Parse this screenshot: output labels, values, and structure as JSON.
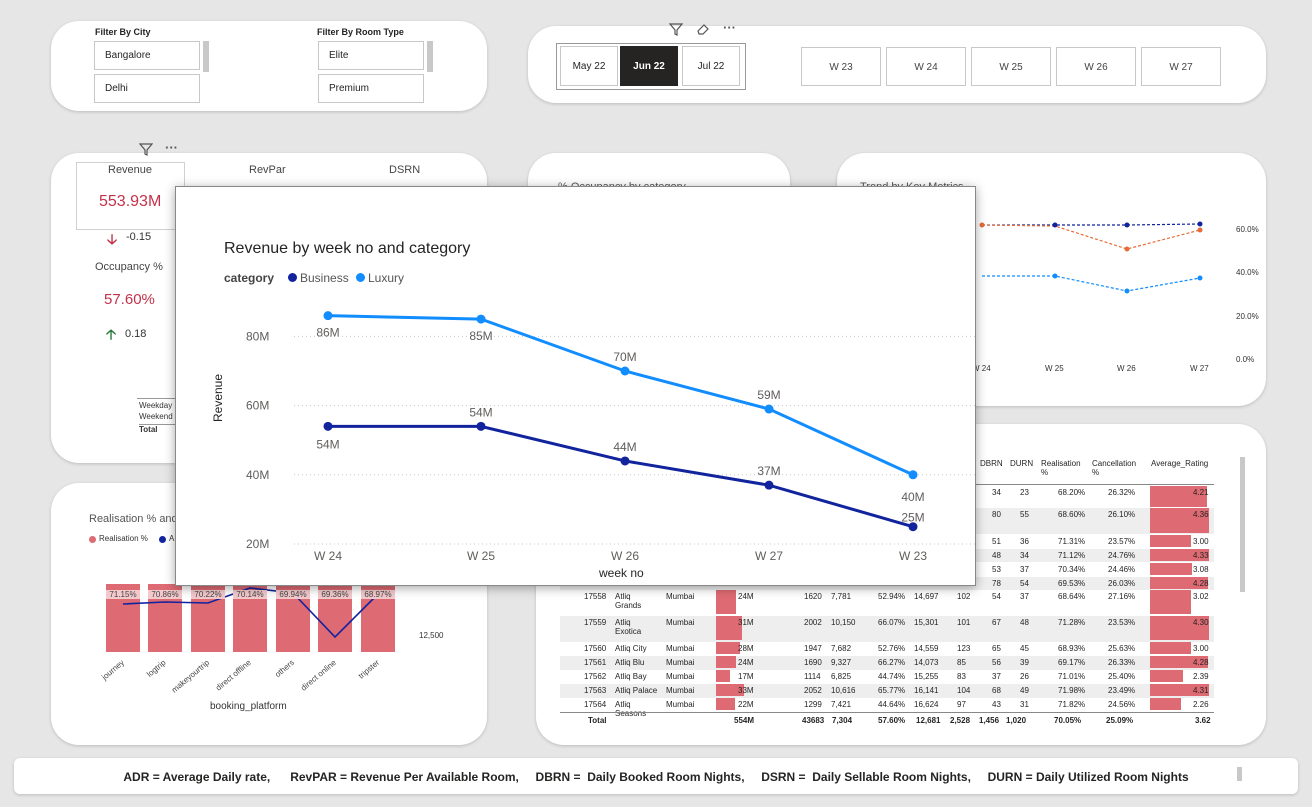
{
  "filters": {
    "city_title": "Filter By City",
    "city_options": [
      "Bangalore",
      "Delhi"
    ],
    "room_title": "Filter By Room Type",
    "room_options": [
      "Elite",
      "Premium"
    ]
  },
  "date_slicer": {
    "months": [
      "May 22",
      "Jun 22",
      "Jul 22"
    ],
    "selected": "Jun 22",
    "weeks": [
      "W 23",
      "W 24",
      "W 25",
      "W 26",
      "W 27"
    ]
  },
  "kpis": {
    "tabs": [
      "Revenue",
      "RevPar",
      "DSRN"
    ],
    "revenue_value": "553.93M",
    "revenue_change": "-0.15",
    "occupancy_label": "Occupancy %",
    "occupancy_value": "57.60%",
    "occupancy_change": "0.18",
    "day_types": [
      "Weekday",
      "Weekend",
      "Total"
    ]
  },
  "partial_titles": {
    "occupancy_card": "% Occupancy by category",
    "trend_card": "Trend by Key Metrics"
  },
  "trend": {
    "weeks": [
      "W 24",
      "W 25",
      "W 26",
      "W 27"
    ],
    "y_ticks": [
      "60.0%",
      "40.0%",
      "20.0%",
      "0.0%"
    ]
  },
  "realisation": {
    "title": "Realisation % and Average Daily Rate by booking_platform",
    "legend": [
      "Realisation %",
      "ADR"
    ],
    "platforms": [
      "journey",
      "logtrip",
      "makeyourtrip",
      "direct offline",
      "others",
      "direct online",
      "tripster"
    ],
    "values": [
      "71.15%",
      "70.86%",
      "70.22%",
      "70.14%",
      "69.94%",
      "69.36%",
      "68.97%"
    ],
    "xlabel": "booking_platform",
    "right_tick": "12,500"
  },
  "table": {
    "headers": [
      "DBRN",
      "DURN",
      "Realisation %",
      "Cancellation %",
      "Average_Rating"
    ],
    "top_rows": [
      [
        "34",
        "23",
        "68.20%",
        "26.32%",
        "4.21"
      ],
      [
        "80",
        "55",
        "68.60%",
        "26.10%",
        "4.36"
      ],
      [
        "51",
        "36",
        "71.31%",
        "23.57%",
        "3.00"
      ],
      [
        "48",
        "34",
        "71.12%",
        "24.76%",
        "4.33"
      ],
      [
        "53",
        "37",
        "70.34%",
        "24.46%",
        "3.08"
      ],
      [
        "78",
        "54",
        "69.53%",
        "26.03%",
        "4.28"
      ]
    ],
    "rows": [
      {
        "id": "17558",
        "name": "Atliq Grands",
        "city": "Mumbai",
        "rev": "24M",
        "a": "1620",
        "b": "7,781",
        "occ": "52.94%",
        "c": "14,697",
        "d": "102",
        "dbrn": "54",
        "durn": "37",
        "real": "68.64%",
        "canc": "27.16%",
        "rating": "3.02"
      },
      {
        "id": "17559",
        "name": "Atliq Exotica",
        "city": "Mumbai",
        "rev": "31M",
        "a": "2002",
        "b": "10,150",
        "occ": "66.07%",
        "c": "15,301",
        "d": "101",
        "dbrn": "67",
        "durn": "48",
        "real": "71.28%",
        "canc": "23.53%",
        "rating": "4.30"
      },
      {
        "id": "17560",
        "name": "Atliq City",
        "city": "Mumbai",
        "rev": "28M",
        "a": "1947",
        "b": "7,682",
        "occ": "52.76%",
        "c": "14,559",
        "d": "123",
        "dbrn": "65",
        "durn": "45",
        "real": "68.93%",
        "canc": "25.63%",
        "rating": "3.00"
      },
      {
        "id": "17561",
        "name": "Atliq Blu",
        "city": "Mumbai",
        "rev": "24M",
        "a": "1690",
        "b": "9,327",
        "occ": "66.27%",
        "c": "14,073",
        "d": "85",
        "dbrn": "56",
        "durn": "39",
        "real": "69.17%",
        "canc": "26.33%",
        "rating": "4.28"
      },
      {
        "id": "17562",
        "name": "Atliq Bay",
        "city": "Mumbai",
        "rev": "17M",
        "a": "1114",
        "b": "6,825",
        "occ": "44.74%",
        "c": "15,255",
        "d": "83",
        "dbrn": "37",
        "durn": "26",
        "real": "71.01%",
        "canc": "25.40%",
        "rating": "2.39"
      },
      {
        "id": "17563",
        "name": "Atliq Palace",
        "city": "Mumbai",
        "rev": "33M",
        "a": "2052",
        "b": "10,616",
        "occ": "65.77%",
        "c": "16,141",
        "d": "104",
        "dbrn": "68",
        "durn": "49",
        "real": "71.98%",
        "canc": "23.49%",
        "rating": "4.31"
      },
      {
        "id": "17564",
        "name": "Atliq Seasons",
        "city": "Mumbai",
        "rev": "22M",
        "a": "1299",
        "b": "7,421",
        "occ": "44.64%",
        "c": "16,624",
        "d": "97",
        "dbrn": "43",
        "durn": "31",
        "real": "71.82%",
        "canc": "24.56%",
        "rating": "2.26"
      }
    ],
    "total": {
      "label": "Total",
      "rev": "554M",
      "a": "43683",
      "b": "7,304",
      "occ": "57.60%",
      "c": "12,681",
      "d": "2,528",
      "dbrn": "1,456",
      "durn": "1,020",
      "real": "70.05%",
      "canc": "25.09%",
      "rating": "3.62"
    }
  },
  "focus_chart": {
    "legend_title": "category",
    "x_title": "week no",
    "y_title": "Revenue"
  },
  "chart_data": {
    "type": "line",
    "title": "Revenue by week no and category",
    "xlabel": "week no",
    "ylabel": "Revenue",
    "categories": [
      "W 24",
      "W 25",
      "W 26",
      "W 27",
      "W 23"
    ],
    "y_ticks": [
      "80M",
      "60M",
      "40M",
      "20M"
    ],
    "ylim": [
      20,
      86
    ],
    "series": [
      {
        "name": "Business",
        "color": "#12239e",
        "values": [
          54,
          54,
          44,
          37,
          25
        ],
        "labels": [
          "54M",
          "54M",
          "44M",
          "37M",
          "25M"
        ]
      },
      {
        "name": "Luxury",
        "color": "#118dff",
        "values": [
          86,
          85,
          70,
          59,
          40
        ],
        "labels": [
          "86M",
          "85M",
          "70M",
          "59M",
          "40M"
        ]
      }
    ],
    "grid": true,
    "legend": "top-left"
  },
  "footer": {
    "text": "ADR = Average Daily rate,      RevPAR = Revenue Per Available Room,     DBRN =  Daily Booked Room Nights,     DSRN =  Daily Sellable Room Nights,     DURN = Daily Utilized Room Nights"
  },
  "colors": {
    "business": "#12239e",
    "luxury": "#118dff",
    "negative": "#c4314b",
    "positive": "#2b7a3f",
    "bar": "#de6a73"
  }
}
